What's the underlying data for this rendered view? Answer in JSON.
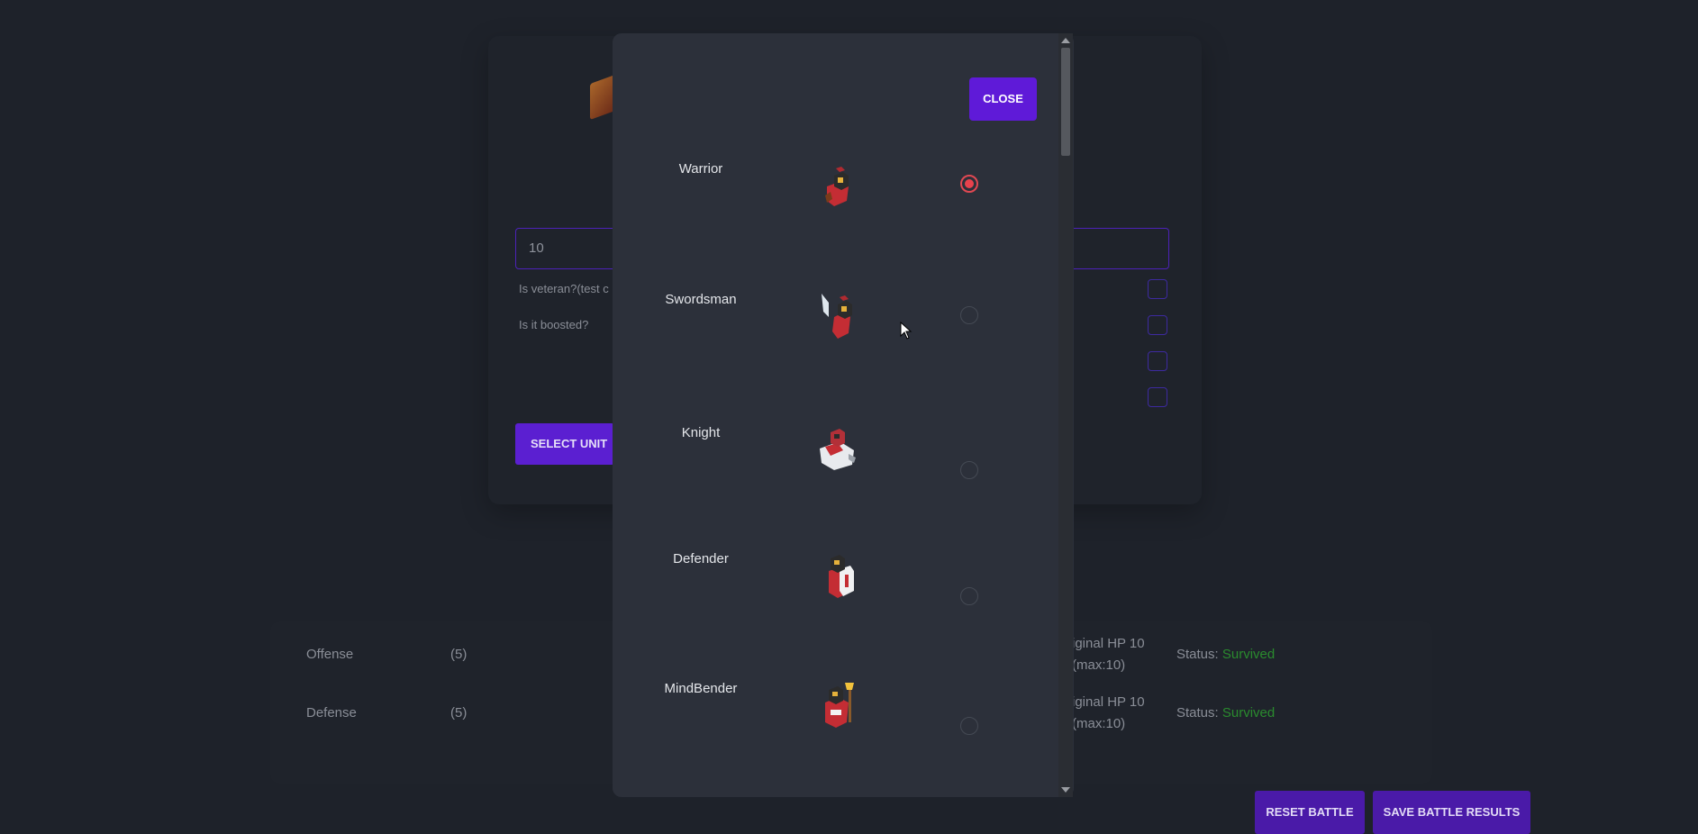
{
  "background": {
    "hp_value": "10",
    "veteran_label": "Is veteran?(test c",
    "boosted_label": "Is it boosted?",
    "select_unit_label": "SELECT UNIT",
    "rows": [
      {
        "label": "Offense",
        "count": "(5)",
        "hp_line1": "iginal HP 10",
        "hp_line2": "(max:10)",
        "status_prefix": "Status:",
        "status": "Survived"
      },
      {
        "label": "Defense",
        "count": "(5)",
        "hp_line1": "iginal HP 10",
        "hp_line2": "(max:10)",
        "status_prefix": "Status:",
        "status": "Survived"
      }
    ],
    "reset_label": "RESET BATTLE",
    "save_label": "SAVE BATTLE RESULTS"
  },
  "modal": {
    "close_label": "CLOSE",
    "units": [
      {
        "name": "Warrior",
        "icon": "warrior-icon",
        "selected": true
      },
      {
        "name": "Swordsman",
        "icon": "swordsman-icon",
        "selected": false
      },
      {
        "name": "Knight",
        "icon": "knight-icon",
        "selected": false
      },
      {
        "name": "Defender",
        "icon": "defender-icon",
        "selected": false
      },
      {
        "name": "MindBender",
        "icon": "mindbender-icon",
        "selected": false
      }
    ]
  },
  "colors": {
    "accent": "#5f1ad8",
    "radio_selected": "#e8424d",
    "status_green": "#2a8b2e"
  }
}
